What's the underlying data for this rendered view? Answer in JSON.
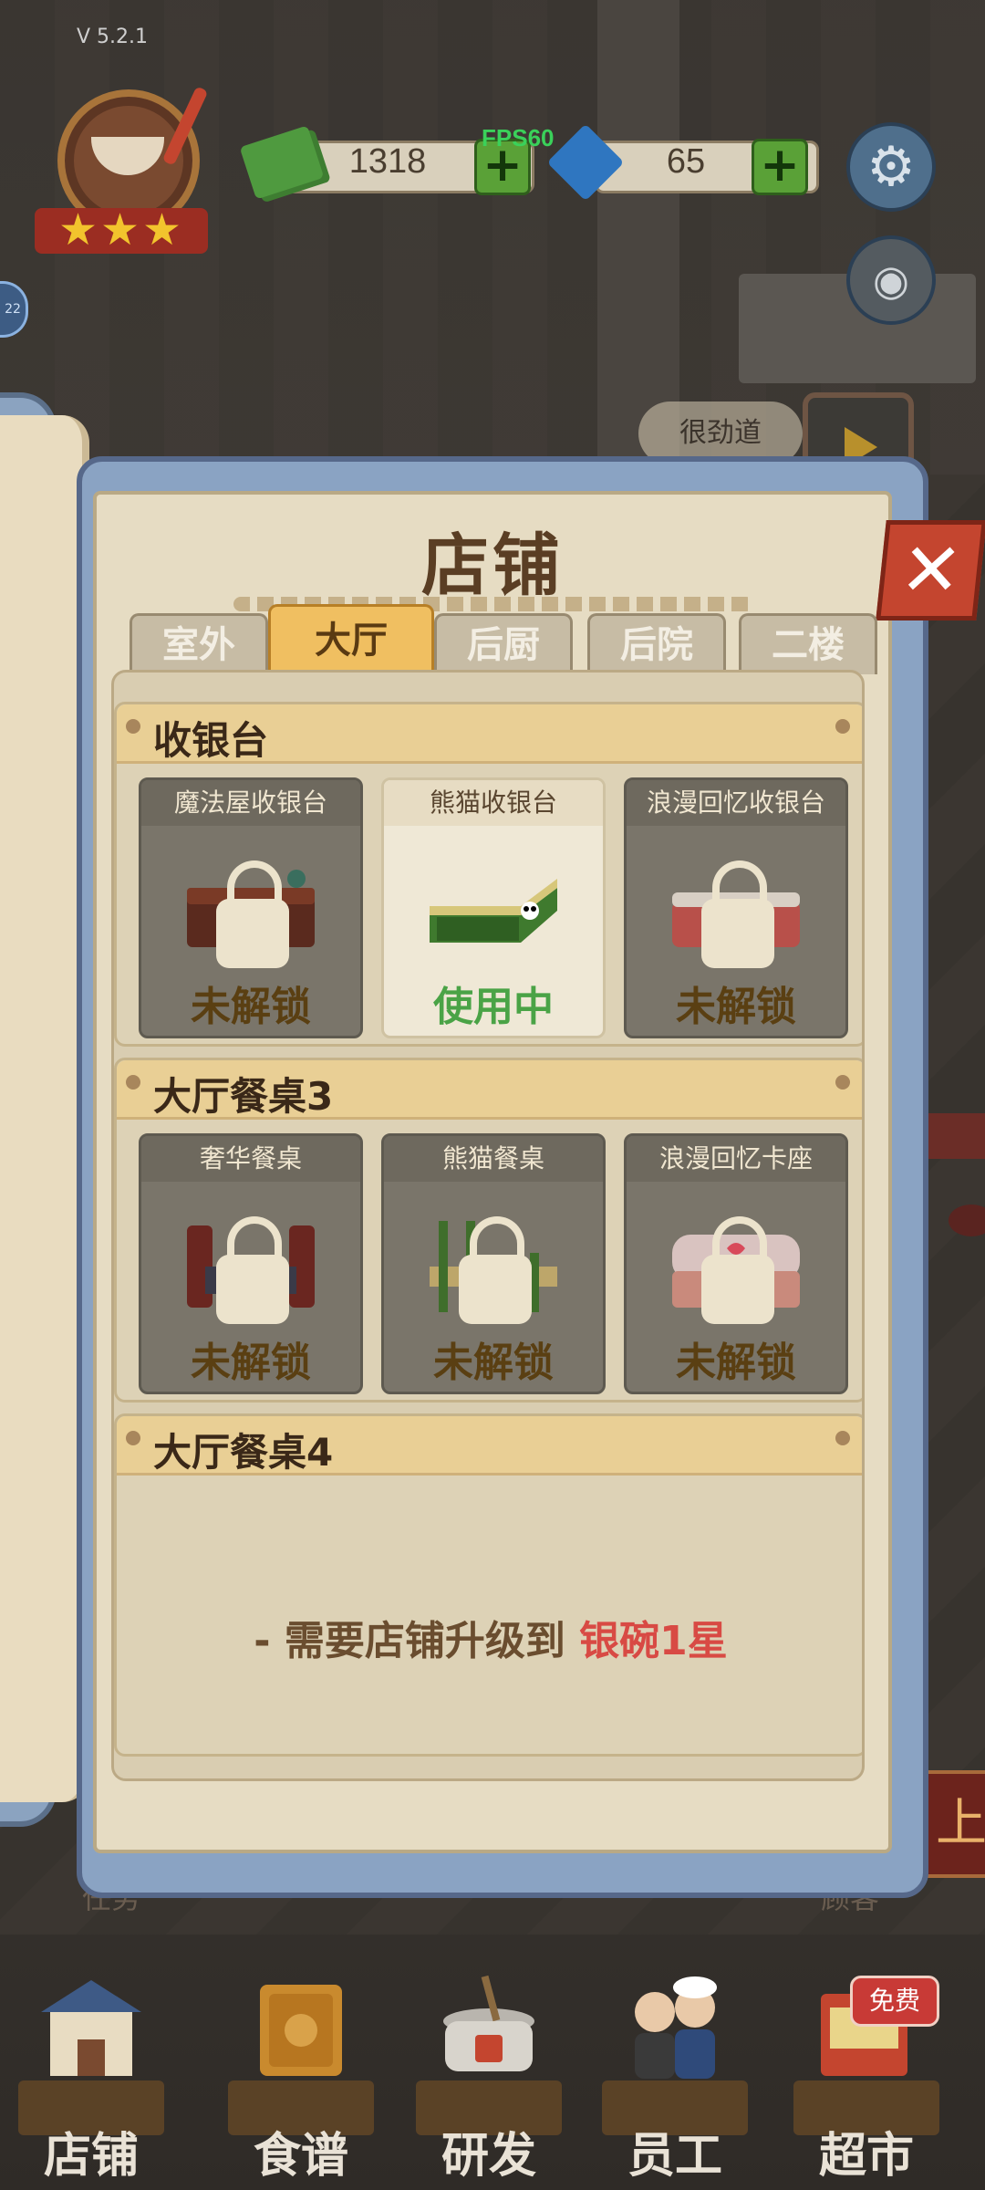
{
  "hud": {
    "version": "V 5.2.1",
    "badge_left": "22",
    "fps": "FPS60",
    "cash": "1318",
    "gems": "65",
    "plus": "+",
    "stars": 3
  },
  "panel": {
    "title": "店铺",
    "close_label": "✕",
    "tabs": [
      {
        "label": "室外",
        "active": false
      },
      {
        "label": "大厅",
        "active": true
      },
      {
        "label": "后厨",
        "active": false
      },
      {
        "label": "后院",
        "active": false
      },
      {
        "label": "二楼",
        "active": false
      }
    ],
    "sections": [
      {
        "title": "收银台",
        "items": [
          {
            "name": "魔法屋收银台",
            "status": "未解锁",
            "locked": true
          },
          {
            "name": "熊猫收银台",
            "status": "使用中",
            "locked": false
          },
          {
            "name": "浪漫回忆收银台",
            "status": "未解锁",
            "locked": true
          }
        ]
      },
      {
        "title": "大厅餐桌3",
        "items": [
          {
            "name": "奢华餐桌",
            "status": "未解锁",
            "locked": true
          },
          {
            "name": "熊猫餐桌",
            "status": "未解锁",
            "locked": true
          },
          {
            "name": "浪漫回忆卡座",
            "status": "未解锁",
            "locked": true
          }
        ]
      },
      {
        "title": "大厅餐桌4",
        "requirement_prefix": "- 需要店铺升级到 ",
        "requirement_target": "银碗1星"
      }
    ]
  },
  "background": {
    "bubble_text": "很劲道",
    "left_label": "任务",
    "right_label": "顾客",
    "sign_text": "上"
  },
  "nav": {
    "items": [
      {
        "label": "店铺"
      },
      {
        "label": "食谱"
      },
      {
        "label": "研发"
      },
      {
        "label": "员工"
      },
      {
        "label": "超市"
      }
    ],
    "free_badge": "免费"
  },
  "colors": {
    "accent_tab": "#f0bf61",
    "in_use_green": "#4aa346",
    "requirement_red": "#d84a44",
    "close_red": "#c4452f",
    "plus_green": "#5aa137",
    "fps_green": "#3ad15a"
  },
  "icons": [
    "cash-icon",
    "gem-icon",
    "gear-icon",
    "camera-icon",
    "close-icon",
    "lock-icon",
    "star-icon"
  ]
}
